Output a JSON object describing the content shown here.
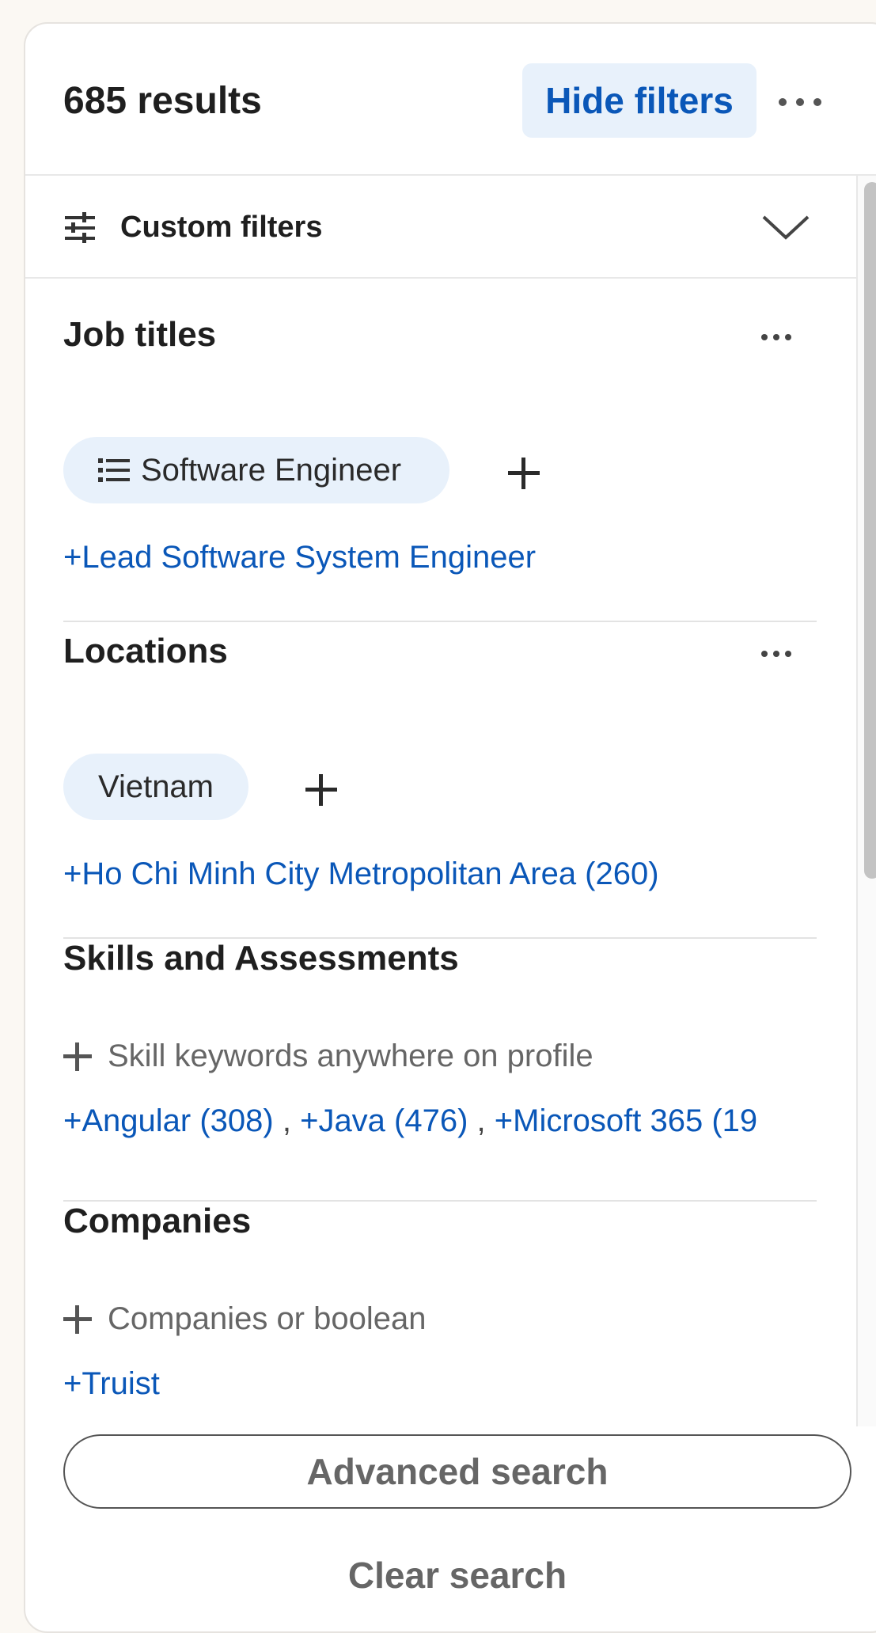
{
  "header": {
    "results": "685 results",
    "hide_filters": "Hide filters"
  },
  "custom_filters": {
    "label": "Custom filters"
  },
  "job_titles": {
    "title": "Job titles",
    "selected": "Software Engineer",
    "suggestion": "+Lead Software System Engineer"
  },
  "locations": {
    "title": "Locations",
    "selected": "Vietnam",
    "suggestion": "+Ho Chi Minh City Metropolitan Area (260)"
  },
  "skills": {
    "title": "Skills and Assessments",
    "placeholder": "Skill keywords anywhere on profile",
    "suggestions": [
      "+Angular (308)",
      "+Java (476)",
      "+Microsoft 365 (19"
    ],
    "separator": " , "
  },
  "companies": {
    "title": "Companies",
    "placeholder": "Companies or boolean",
    "suggestion": "+Truist"
  },
  "footer": {
    "advanced_search": "Advanced search",
    "clear_search": "Clear search"
  },
  "colors": {
    "accent": "#0a57b8",
    "pill_bg": "#e8f1fb",
    "page_bg": "#fbf8f3"
  },
  "icons": {
    "custom_filters": "sliders-icon",
    "chevron": "chevron-down-icon",
    "more": "ellipsis-icon",
    "list": "list-icon",
    "add": "plus-icon"
  }
}
